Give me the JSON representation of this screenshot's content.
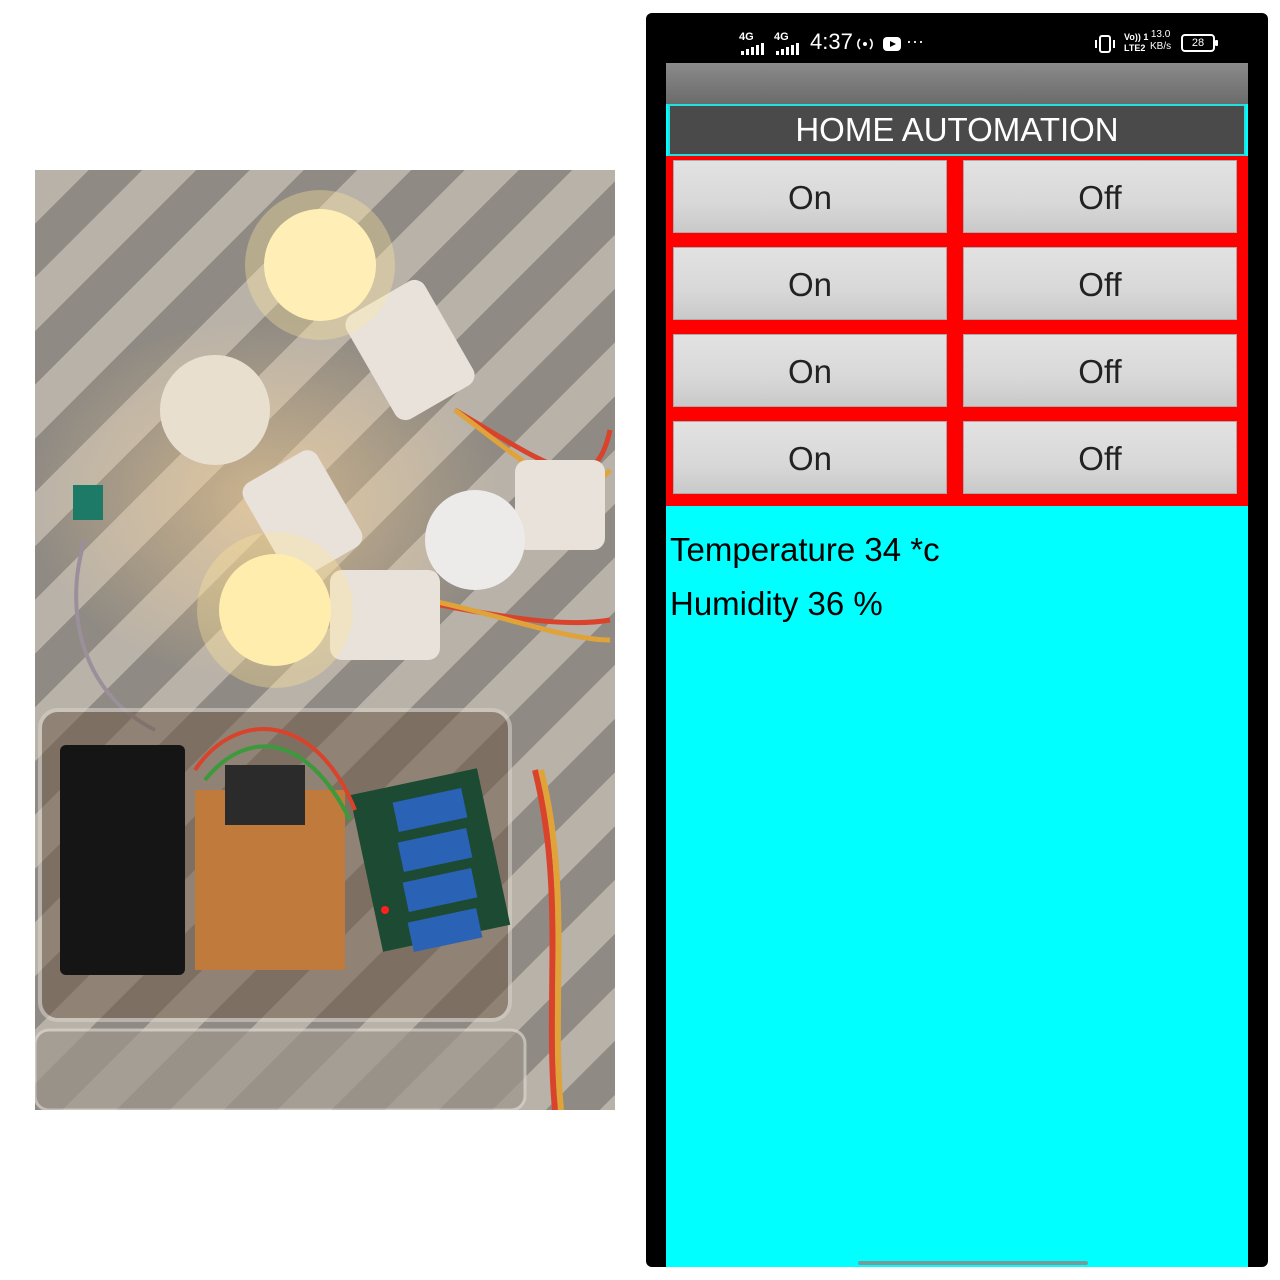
{
  "status_bar": {
    "network_1": "4G",
    "network_2": "4G",
    "time": "4:37",
    "volte": "Vo)) 1",
    "lte": "LTE2",
    "speed_value": "13.0",
    "speed_unit": "KB/s",
    "battery": "28",
    "more": "···"
  },
  "app": {
    "title": "HOME AUTOMATION",
    "switches": [
      {
        "on_label": "On",
        "off_label": "Off"
      },
      {
        "on_label": "On",
        "off_label": "Off"
      },
      {
        "on_label": "On",
        "off_label": "Off"
      },
      {
        "on_label": "On",
        "off_label": "Off"
      }
    ],
    "temperature": "Temperature 34 *c",
    "humidity": "Humidity 36 %"
  },
  "colors": {
    "app_background": "#00ffff",
    "button_grid_background": "#ff0000",
    "header_background": "#4a4a4a"
  }
}
